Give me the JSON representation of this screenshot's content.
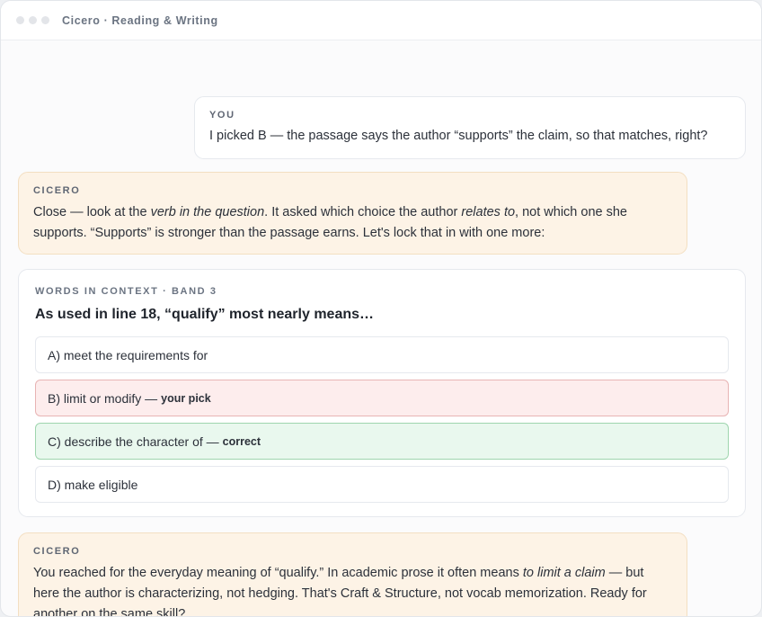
{
  "window": {
    "title": "Cicero · Reading & Writing"
  },
  "messages": {
    "user_1": {
      "speaker": "YOU",
      "text": "I picked B — the passage says the author “supports” the claim, so that matches, right?"
    },
    "bot_1": {
      "speaker": "CICERO",
      "parts": [
        "Close — look at the ",
        "verb in the question",
        ". It asked which choice the author ",
        "relates to",
        ", not which one she supports. “Supports” is stronger than the passage earns. Let's lock that in with one more:"
      ]
    },
    "bot_2": {
      "speaker": "CICERO",
      "parts": [
        "You reached for the everyday meaning of “qualify.” In academic prose it often means ",
        "to limit a claim",
        " — but here the author is characterizing, not hedging. That's Craft & Structure, not vocab memorization. Ready for another on the same skill?"
      ]
    }
  },
  "question_card": {
    "label": "WORDS IN CONTEXT · BAND 3",
    "question": "As used in line 18, “qualify” most nearly means…",
    "options": [
      {
        "text": "A) meet the requirements for",
        "tag": ""
      },
      {
        "text": "B) limit or modify — ",
        "tag": "your pick"
      },
      {
        "text": "C) describe the character of — ",
        "tag": "correct"
      },
      {
        "text": "D) make eligible",
        "tag": ""
      }
    ]
  },
  "colors": {
    "assistant_bubble": "#fdf3e6",
    "wrong_option": "#fdeded",
    "correct_option": "#e9f8ee"
  }
}
